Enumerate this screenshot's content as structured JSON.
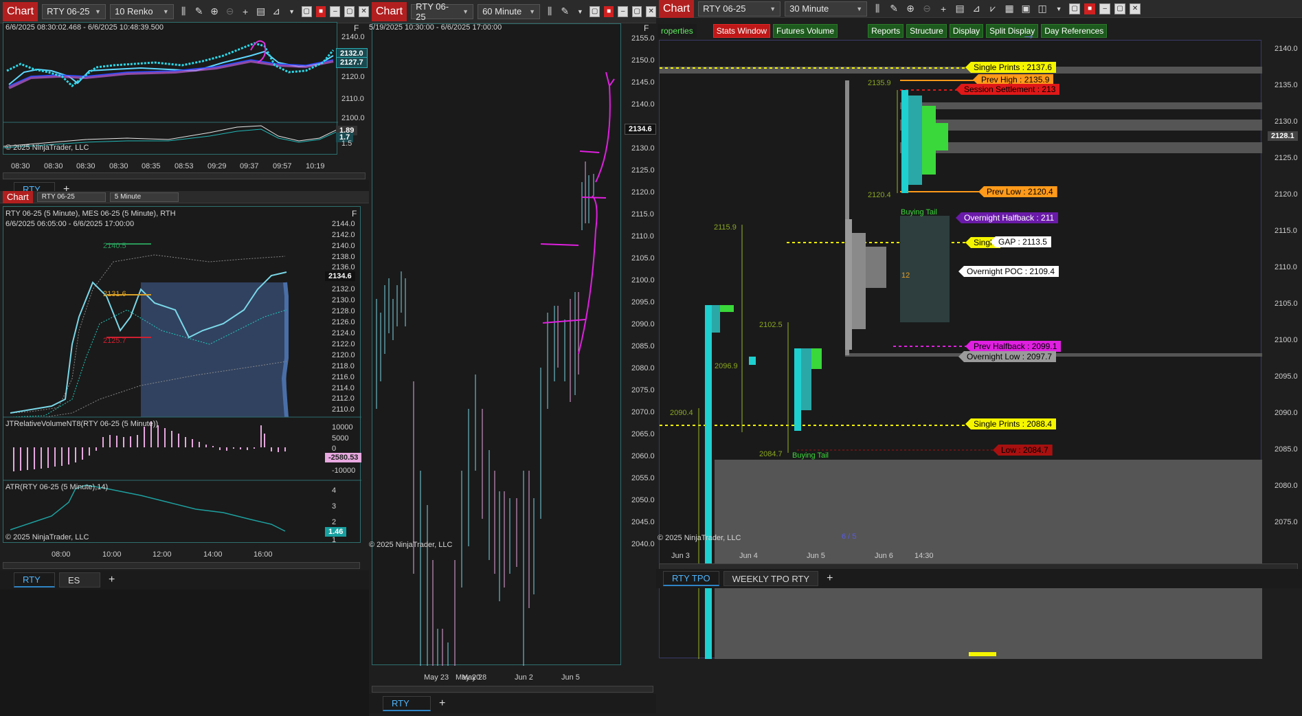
{
  "win1": {
    "chart_label": "Chart",
    "instrument": "RTY 06-25",
    "period": "10 Renko",
    "range_text": "6/6/2025 08:30:02.468 - 6/6/2025 10:48:39.500",
    "copyright": "© 2025 NinjaTrader, LLC",
    "price_ticks": [
      "2140.0",
      "2132.0",
      "2127.7",
      "2120.0",
      "2110.0",
      "2100.0"
    ],
    "osc_ticks": [
      "1.89",
      "1.7",
      "1.5"
    ],
    "time_ticks": [
      "08:30",
      "08:30",
      "08:30",
      "08:30",
      "08:35",
      "08:53",
      "09:29",
      "09:37",
      "09:57",
      "10:19"
    ],
    "tab": "RTY",
    "f_label": "F"
  },
  "win2": {
    "chart_label": "Chart",
    "instrument": "RTY 06-25",
    "period": "5 Minute",
    "title": "RTY 06-25 (5 Minute), MES 06-25 (5 Minute), RTH",
    "range_text": "6/6/2025 06:05:00 - 6/6/2025 17:00:00",
    "price_ticks": [
      "2144.0",
      "2142.0",
      "2140.0",
      "2138.0",
      "2136.0",
      "2134.6",
      "2132.0",
      "2130.0",
      "2128.0",
      "2126.0",
      "2124.0",
      "2122.0",
      "2120.0",
      "2118.0",
      "2116.0",
      "2114.0",
      "2112.0",
      "2110.0"
    ],
    "level_labels": [
      "2140.5",
      "2131.6",
      "2125.7"
    ],
    "indicator1": "JTRelativeVolumeNT8(RTY 06-25 (5 Minute))",
    "ind1_ticks": [
      "10000",
      "5000",
      "0",
      "-2580.53",
      "-10000"
    ],
    "indicator2": "ATR(RTY 06-25 (5 Minute),14)",
    "ind2_ticks": [
      "4",
      "3",
      "2",
      "1.46",
      "1"
    ],
    "time_ticks": [
      "08:00",
      "10:00",
      "12:00",
      "14:00",
      "16:00"
    ],
    "copyright": "© 2025 NinjaTrader, LLC",
    "tabs": [
      "RTY",
      "ES"
    ],
    "f_label": "F"
  },
  "win3": {
    "chart_label": "Chart",
    "instrument": "RTY 06-25",
    "period": "60 Minute",
    "range_text": "5/19/2025 10:30:00 - 6/6/2025 17:00:00",
    "price_ticks": [
      "2155.0",
      "2150.0",
      "2145.0",
      "2140.0",
      "2134.6",
      "2130.0",
      "2125.0",
      "2120.0",
      "2115.0",
      "2110.0",
      "2105.0",
      "2100.0",
      "2095.0",
      "2090.0",
      "2085.0",
      "2080.0",
      "2075.0",
      "2070.0",
      "2065.0",
      "2060.0",
      "2055.0",
      "2050.0",
      "2045.0",
      "2040.0"
    ],
    "date_ticks": [
      "May 20",
      "May 23",
      "May 28",
      "Jun 2",
      "Jun 5"
    ],
    "copyright": "© 2025 NinjaTrader, LLC",
    "tab": "RTY",
    "f_label": "F"
  },
  "win4": {
    "chart_label": "Chart",
    "instrument": "RTY 06-25",
    "period": "30 Minute",
    "buttons": [
      "roperties",
      "Stats Window",
      "Futures Volume",
      "Reports",
      "Structure",
      "Display",
      "Split Display",
      "Day References"
    ],
    "price_ticks": [
      "2140.0",
      "2135.0",
      "2130.0",
      "2128.1",
      "2125.0",
      "2120.0",
      "2115.0",
      "2110.0",
      "2105.0",
      "2100.0",
      "2095.0",
      "2090.0",
      "2085.0",
      "2080.0",
      "2075.0"
    ],
    "level_tags": [
      {
        "text": "Single Prints : 2137.6",
        "color": "#f5f500"
      },
      {
        "text": "Prev High : 2135.9",
        "color": "#ff9a1a"
      },
      {
        "text": "Session Settlement : 213",
        "color": "#e01818"
      },
      {
        "text": "Prev Low : 2120.4",
        "color": "#ff9a1a"
      },
      {
        "text": "Overnight Halfback : 211",
        "color": "#6a1aa8"
      },
      {
        "text": "Single",
        "color": "#f5f500"
      },
      {
        "text": "GAP : 2113.5",
        "color": "#ffffff"
      },
      {
        "text": "Overnight POC : 2109.4",
        "color": "#ffffff"
      },
      {
        "text": "Prev Halfback : 2099.1",
        "color": "#e020e0"
      },
      {
        "text": "Overnight Low : 2097.7",
        "color": "#9a9a9a"
      },
      {
        "text": "Single Prints : 2088.4",
        "color": "#f5f500"
      },
      {
        "text": "Low : 2084.7",
        "color": "#a81010"
      }
    ],
    "profile_labels": [
      "2135.9",
      "2120.4",
      "Buying Tail",
      "2115.9",
      "12",
      "2102.5",
      "2096.9",
      "2090.4",
      "2084.7",
      "Buying Tail",
      "6 / 5"
    ],
    "date_ticks": [
      "Jun 3",
      "Jun 4",
      "Jun 5",
      "Jun 6",
      "14:30"
    ],
    "copyright": "© 2025 NinjaTrader, LLC",
    "tabs": [
      "RTY TPO",
      "WEEKLY TPO RTY"
    ]
  }
}
